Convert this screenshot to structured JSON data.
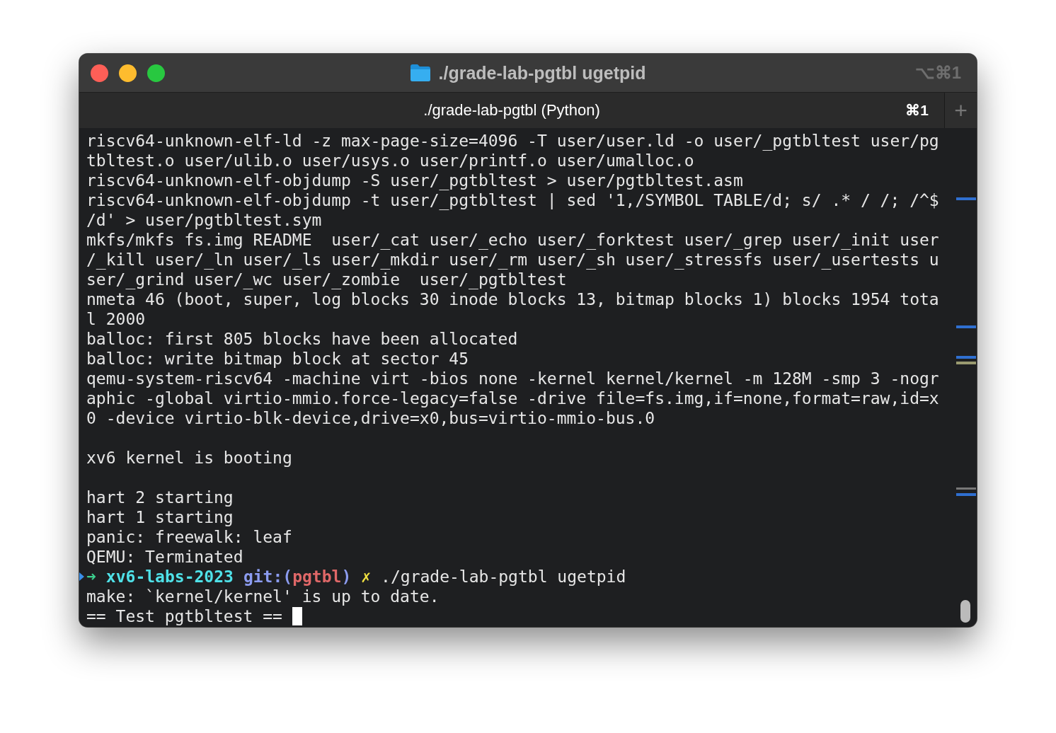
{
  "window": {
    "title": "./grade-lab-pgtbl ugetpid",
    "shortcut": "⌥⌘1"
  },
  "tabs": [
    {
      "label": "./grade-lab-pgtbl (Python)",
      "shortcut": "⌘1",
      "selected": true
    }
  ],
  "new_tab": "+",
  "terminal": {
    "blocks": [
      [
        "riscv64-unknown-elf-ld -z max-page-size=4096 -T user/user.ld -o user/_pgtbltest user/pg",
        "tbltest.o user/ulib.o user/usys.o user/printf.o user/umalloc.o",
        "riscv64-unknown-elf-objdump -S user/_pgtbltest > user/pgtbltest.asm",
        "riscv64-unknown-elf-objdump -t user/_pgtbltest | sed '1,/SYMBOL TABLE/d; s/ .* / /; /^$",
        "/d' > user/pgtbltest.sym",
        "mkfs/mkfs fs.img README  user/_cat user/_echo user/_forktest user/_grep user/_init user",
        "/_kill user/_ln user/_ls user/_mkdir user/_rm user/_sh user/_stressfs user/_usertests u",
        "ser/_grind user/_wc user/_zombie  user/_pgtbltest",
        "nmeta 46 (boot, super, log blocks 30 inode blocks 13, bitmap blocks 1) blocks 1954 tota",
        "l 2000",
        "balloc: first 805 blocks have been allocated",
        "balloc: write bitmap block at sector 45",
        "qemu-system-riscv64 -machine virt -bios none -kernel kernel/kernel -m 128M -smp 3 -nogr",
        "aphic -global virtio-mmio.force-legacy=false -drive file=fs.img,if=none,format=raw,id=x",
        "0 -device virtio-blk-device,drive=x0,bus=virtio-mmio-bus.0"
      ],
      [
        "xv6 kernel is booting"
      ],
      [
        "hart 2 starting",
        "hart 1 starting",
        "panic: freewalk: leaf",
        "QEMU: Terminated"
      ]
    ],
    "prompt": [
      {
        "kind": "arrow",
        "text": "➜"
      },
      {
        "kind": "dir",
        "text": "xv6-labs-2023"
      },
      {
        "kind": "git",
        "text": "git:("
      },
      {
        "kind": "branch",
        "text": "pgtbl"
      },
      {
        "kind": "git",
        "text": ")"
      },
      {
        "kind": "dirty",
        "text": "✗"
      },
      {
        "kind": "command",
        "text": "./grade-lab-pgtbl ugetpid"
      }
    ],
    "after": [
      "make: `kernel/kernel' is up to date.",
      "== Test pgtbltest =="
    ]
  }
}
